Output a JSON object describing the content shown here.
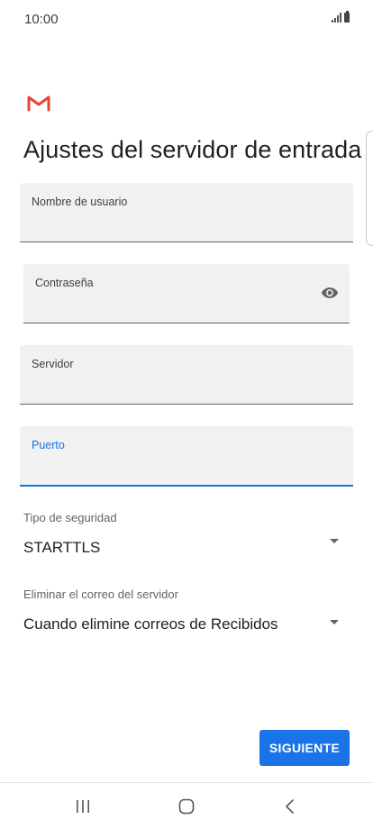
{
  "status_bar": {
    "time": "10:00",
    "icons": [
      "signal-icon",
      "battery-icon"
    ]
  },
  "app": {
    "logo_icon": "gmail-logo-icon",
    "title": "Ajustes del servidor de entrada"
  },
  "fields": {
    "username": {
      "label": "Nombre de usuario",
      "value": ""
    },
    "password": {
      "label": "Contraseña",
      "value": "",
      "toggle_icon": "eye-icon"
    },
    "server": {
      "label": "Servidor",
      "value": ""
    },
    "port": {
      "label": "Puerto",
      "value": "",
      "focused": true
    }
  },
  "security": {
    "label": "Tipo de seguridad",
    "selected": "STARTTLS"
  },
  "delete_mail": {
    "label": "Eliminar el correo del servidor",
    "selected": "Cuando elimine correos de Recibidos"
  },
  "actions": {
    "next_label": "SIGUIENTE"
  },
  "nav": {
    "icons": [
      "recent-apps-icon",
      "home-icon",
      "back-icon"
    ]
  },
  "colors": {
    "accent": "#1a73e8",
    "gmail_red": "#ea4335",
    "field_bg": "#f1f1f1"
  }
}
